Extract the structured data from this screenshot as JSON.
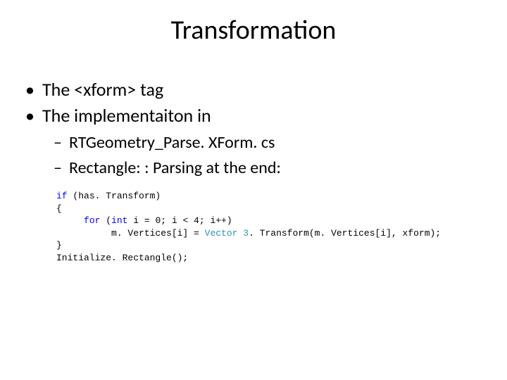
{
  "title": "Transformation",
  "bullets": [
    "The <xform> tag",
    "The implementaiton in"
  ],
  "sub_bullets": [
    "RTGeometry_Parse. XForm. cs",
    "Rectangle: : Parsing at the end:"
  ],
  "code": {
    "l1_kw1": "if",
    "l1_rest": " (has. Transform)",
    "l2": "{",
    "l3_indent": "     ",
    "l3_kw1": "for",
    "l3_a": " (",
    "l3_kw2": "int",
    "l3_rest": " i = 0; i < 4; i++)",
    "l4_indent": "          ",
    "l4_a": "m. Vertices[i] = ",
    "l4_typ": "Vector 3",
    "l4_rest": ". Transform(m. Vertices[i], xform);",
    "l5": "}",
    "l6": "Initialize. Rectangle();"
  }
}
